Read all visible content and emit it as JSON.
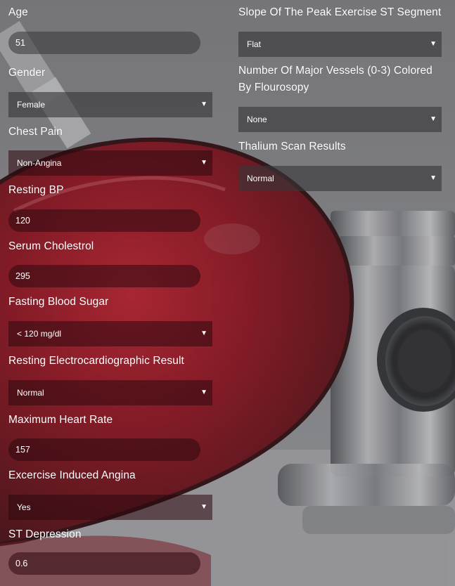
{
  "form": {
    "age": {
      "label": "Age",
      "value": "51"
    },
    "gender": {
      "label": "Gender",
      "value": "Female"
    },
    "chest_pain": {
      "label": "Chest Pain",
      "value": "Non-Angina"
    },
    "resting_bp": {
      "label": "Resting BP",
      "value": "120"
    },
    "serum_cholesterol": {
      "label": "Serum Cholestrol",
      "value": "295"
    },
    "fasting_blood_sugar": {
      "label": "Fasting Blood Sugar",
      "value": "< 120 mg/dl"
    },
    "resting_ecg": {
      "label": "Resting Electrocardiographic Result",
      "value": "Normal"
    },
    "max_heart_rate": {
      "label": "Maximum Heart Rate",
      "value": "157"
    },
    "exercise_angina": {
      "label": "Excercise Induced Angina",
      "value": "Yes"
    },
    "st_depression": {
      "label": "ST Depression",
      "value": "0.6"
    },
    "st_slope": {
      "label": "Slope Of The Peak Exercise ST Segment",
      "value": "Flat"
    },
    "major_vessels": {
      "label": "Number Of Major Vessels (0-3) Colored By Flourosopy",
      "value": "None"
    },
    "thalium_scan": {
      "label": "Thalium Scan Results",
      "value": "Normal"
    }
  },
  "icons": {
    "dropdown": "caret-down-icon"
  },
  "colors": {
    "text": "#ffffff",
    "field_background": "#37373a",
    "heart": "#b0101e",
    "backdrop": "#7f7f83"
  }
}
